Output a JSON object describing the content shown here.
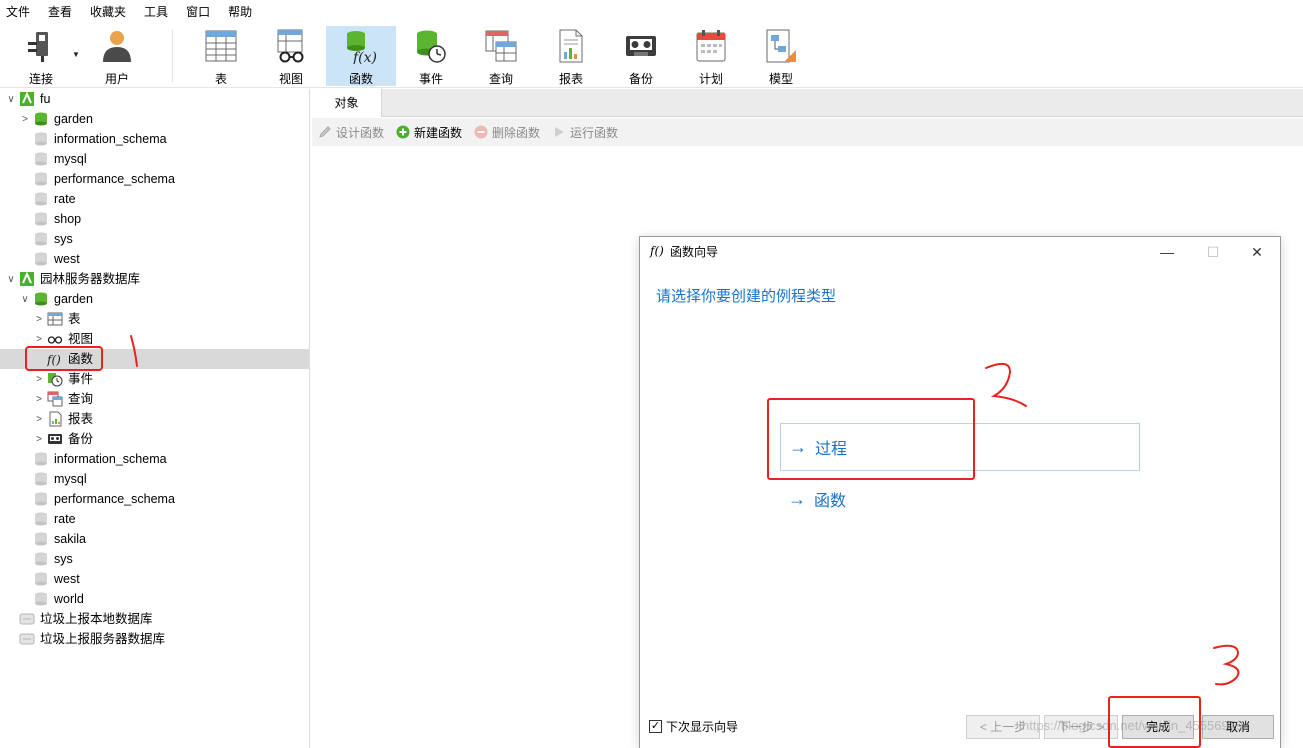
{
  "menu": [
    "文件",
    "查看",
    "收藏夹",
    "工具",
    "窗口",
    "帮助"
  ],
  "toolbar": {
    "connect": "连接",
    "user": "用户",
    "table": "表",
    "view": "视图",
    "function": "函数",
    "event": "事件",
    "query": "查询",
    "report": "报表",
    "backup": "备份",
    "schedule": "计划",
    "model": "模型"
  },
  "tree": {
    "conn1": "fu",
    "conn1_dbs": [
      "garden",
      "information_schema",
      "mysql",
      "performance_schema",
      "rate",
      "shop",
      "sys",
      "west"
    ],
    "conn2": "园林服务器数据库",
    "conn2_db_open": "garden",
    "conn2_objects": [
      "表",
      "视图",
      "函数",
      "事件",
      "查询",
      "报表",
      "备份"
    ],
    "conn2_dbs": [
      "information_schema",
      "mysql",
      "performance_schema",
      "rate",
      "sakila",
      "sys",
      "west",
      "world"
    ],
    "conn3": "垃圾上报本地数据库",
    "conn4": "垃圾上报服务器数据库"
  },
  "object_panel": {
    "tab": "对象",
    "design": "设计函数",
    "new": "新建函数",
    "delete": "删除函数",
    "run": "运行函数"
  },
  "dialog": {
    "title": "函数向导",
    "heading": "请选择你要创建的例程类型",
    "option_procedure": "过程",
    "option_function": "函数",
    "show_wizard": "下次显示向导",
    "prev": "< 上一步",
    "next": "下一步 >",
    "finish": "完成",
    "cancel": "取消"
  },
  "watermark": "https://blog.csdn.net/weixin_45556979",
  "annotations": [
    "1",
    "2",
    "3"
  ],
  "colors": {
    "accent": "#1a73c9",
    "selected_tool": "#cce4f7",
    "annotation": "#e8231d",
    "db_green": "#5cb531"
  }
}
